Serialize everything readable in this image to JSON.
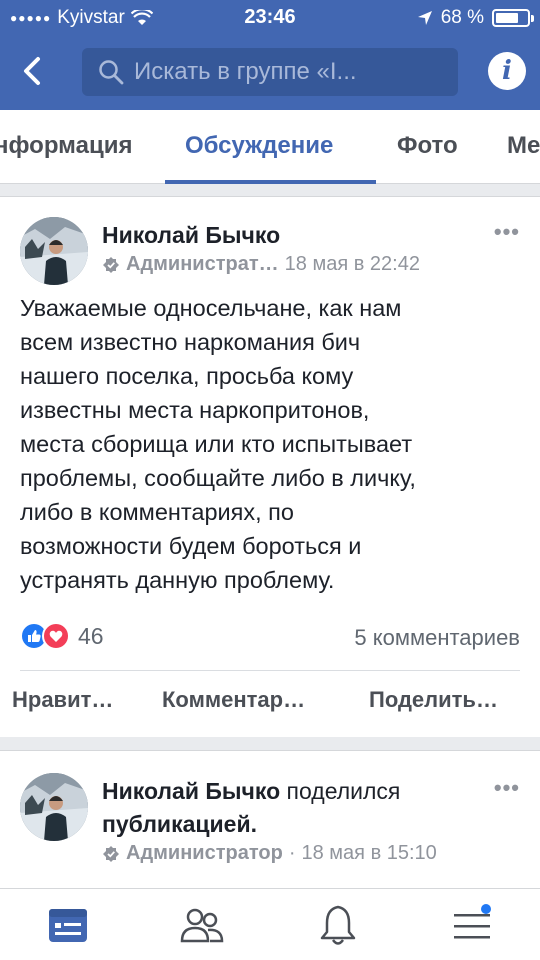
{
  "status": {
    "carrier": "Kyivstar",
    "time": "23:46",
    "battery": "68 %",
    "battery_level": 0.68
  },
  "search": {
    "placeholder": "Искать в группе «I..."
  },
  "tabs": [
    {
      "label": "нформация"
    },
    {
      "label": "Обсуждение"
    },
    {
      "label": "Фото"
    },
    {
      "label": "Ме"
    }
  ],
  "posts": [
    {
      "author": "Николай Бычко",
      "role": "Администрат…",
      "date": "18 мая в 22:42",
      "text": "Уважаемые односельчане, как нам\nвсем известно наркомания бич\nнашего поселка, просьба кому\nизвестны  места наркопритонов,\nместа сборища или кто испытывает\nпроблемы, сообщайте либо в личку,\nлибо в комментариях, по\nвозможности будем бороться и\nустранять данную проблему.",
      "reactions_count": "46",
      "comments": "5 комментариев",
      "actions": [
        "Нравит…",
        "Комментар…",
        "Поделить…"
      ]
    },
    {
      "author": "Николай Бычко",
      "shared_text": "поделился",
      "shared_text2": "публикацией.",
      "role": "Администратор",
      "separator": "·",
      "date": "18 мая в 15:10"
    }
  ],
  "colors": {
    "brand": "#4267b2",
    "like": "#2078f4",
    "love": "#f33e58"
  },
  "icons": [
    "back-arrow-icon",
    "search-icon",
    "info-icon",
    "more-icon",
    "admin-badge-icon",
    "like-reaction-icon",
    "love-reaction-icon",
    "feed-icon",
    "friends-icon",
    "bell-icon",
    "menu-icon"
  ]
}
